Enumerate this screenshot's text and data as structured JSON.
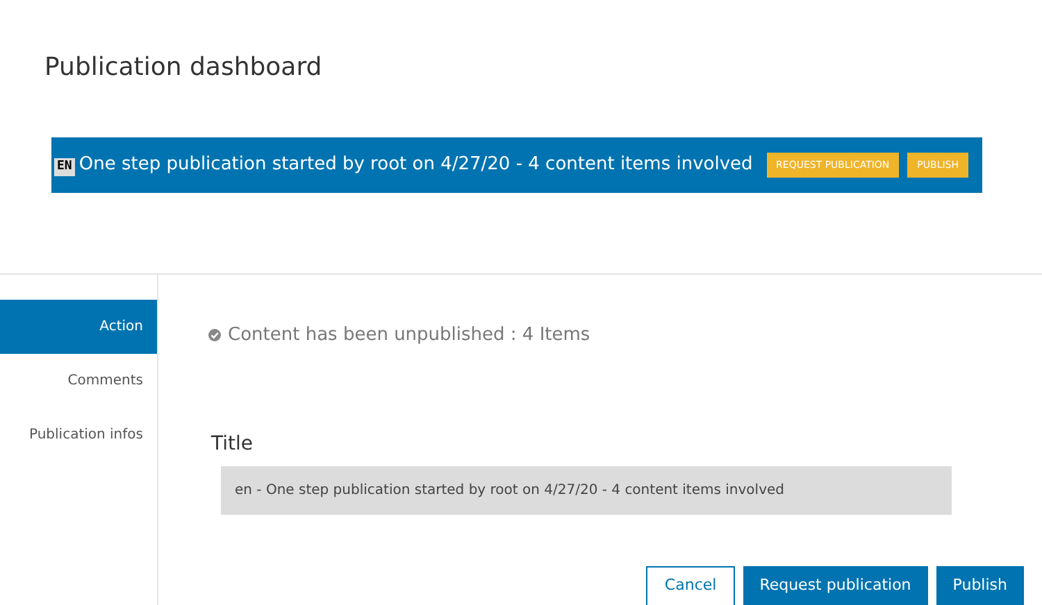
{
  "page_title": "Publication dashboard",
  "banner": {
    "language": "EN",
    "text": "One step publication started by root on 4/27/20 - 4 content items involved",
    "buttons": [
      "REQUEST PUBLICATION",
      "PUBLISH"
    ]
  },
  "sidebar": {
    "items": [
      {
        "label": "Action",
        "selected": true
      },
      {
        "label": "Comments",
        "selected": false
      },
      {
        "label": "Publication infos",
        "selected": false
      }
    ]
  },
  "status": "Content has been unpublished : 4 Items",
  "title_field": {
    "label": "Title",
    "value": "en - One step publication started by root on 4/27/20 - 4 content items involved"
  },
  "buttons": [
    {
      "label": "Cancel",
      "kind": "outline"
    },
    {
      "label": "Request publication",
      "kind": "primary"
    },
    {
      "label": "Publish",
      "kind": "primary"
    }
  ]
}
